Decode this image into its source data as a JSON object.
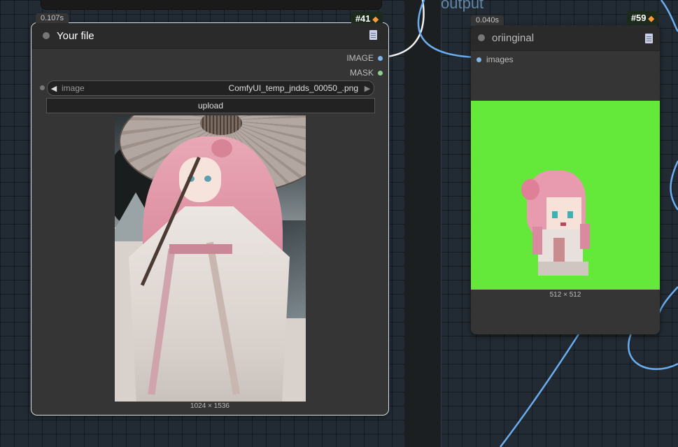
{
  "group": {
    "title": "output"
  },
  "node_file": {
    "timing": "0.107s",
    "badge_id": "#41",
    "badge_icon": "fox-icon",
    "title": "Your file",
    "outputs": [
      {
        "label": "IMAGE",
        "color": "#7eb6e6"
      },
      {
        "label": "MASK",
        "color": "#8fcf8f"
      }
    ],
    "widget": {
      "label": "image",
      "value": "ComfyUI_temp_jndds_00050_.png"
    },
    "upload_label": "upload",
    "image_dims": "1024 × 1536"
  },
  "node_orig": {
    "timing": "0.040s",
    "badge_id": "#59",
    "badge_icon": "fox-icon",
    "title": "oriinginal",
    "inputs": [
      {
        "label": "images",
        "color": "#7eb6e6"
      }
    ],
    "image_dims": "512 × 512",
    "image_bg": "#64e83a"
  },
  "colors": {
    "link": "#6aaef0",
    "canvas": "#222a33"
  }
}
